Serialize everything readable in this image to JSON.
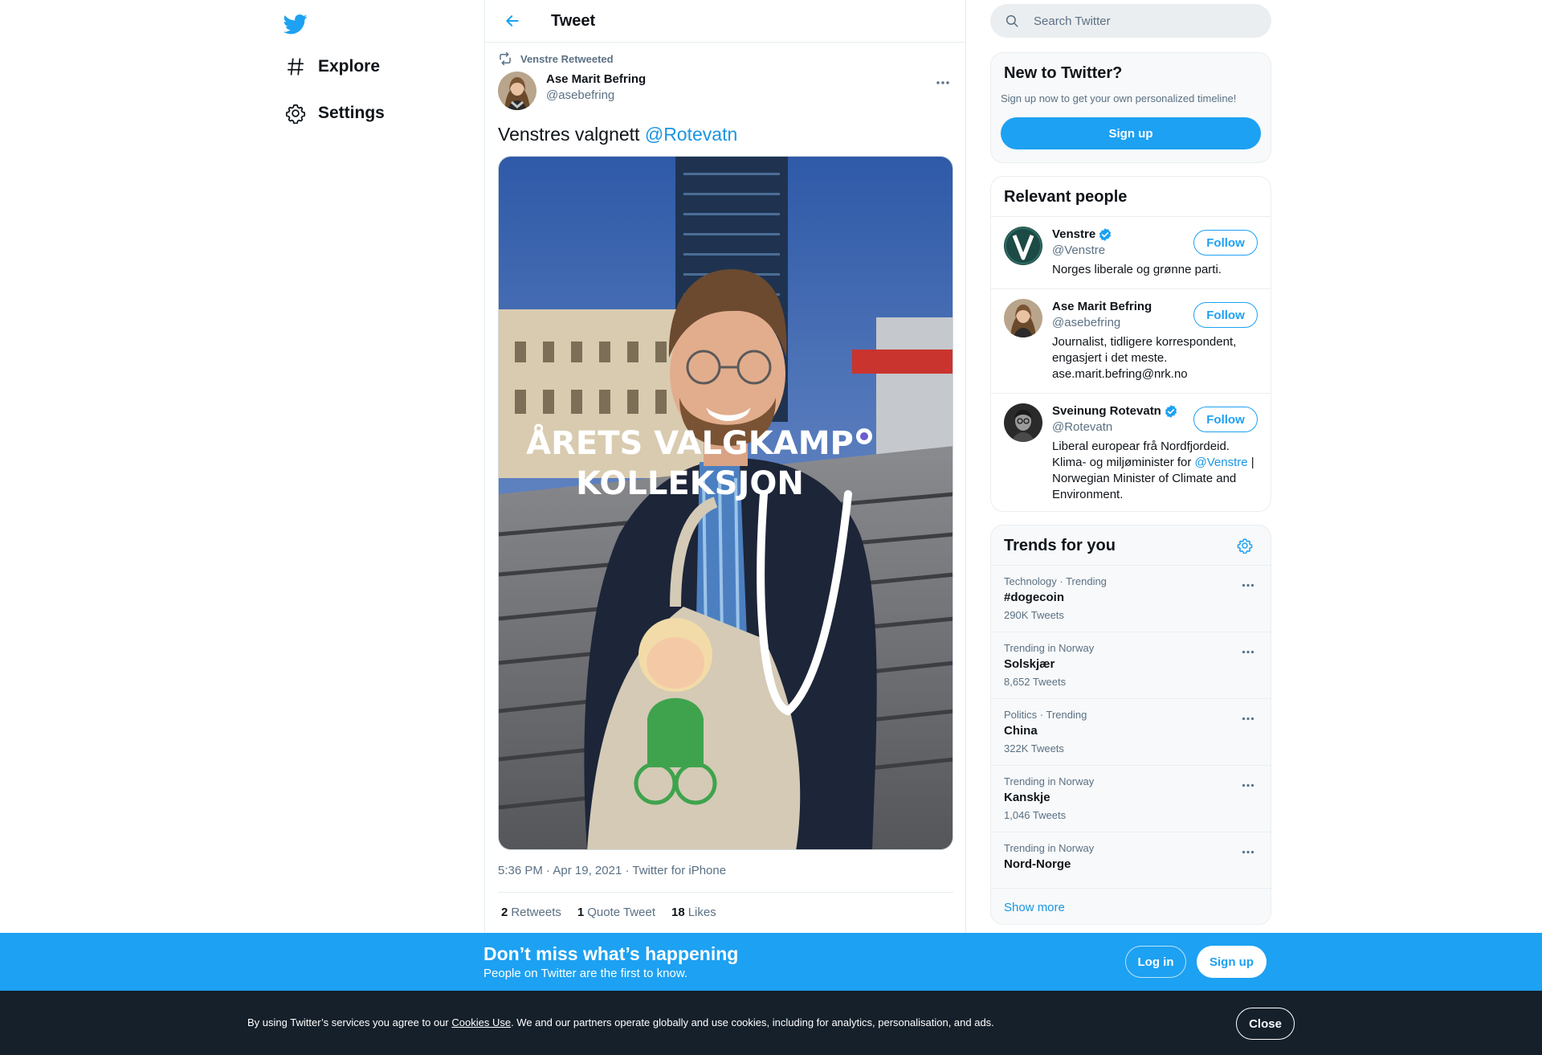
{
  "nav": {
    "logo_icon": "twitter-bird-icon",
    "items": [
      {
        "label": "Explore",
        "icon": "hash-icon"
      },
      {
        "label": "Settings",
        "icon": "gear-icon"
      }
    ]
  },
  "header": {
    "title": "Tweet",
    "back_icon": "arrow-left-icon"
  },
  "tweet": {
    "retweeted_by": "Venstre Retweeted",
    "author_name": "Ase Marit Befring",
    "author_handle": "@asebefring",
    "text": "Venstres valgnett ",
    "mention": "@Rotevatn",
    "media_caption_line1": "ÅRETS VALGKAMP",
    "media_caption_line2": "KOLLEKSJON",
    "time": "5:36 PM",
    "date": "Apr 19, 2021",
    "separator": " · ",
    "source": "Twitter for iPhone",
    "stats": {
      "retweets_count": "2",
      "retweets_label": "Retweets",
      "quotes_count": "1",
      "quotes_label": "Quote Tweet",
      "likes_count": "18",
      "likes_label": "Likes"
    }
  },
  "search": {
    "placeholder": "Search Twitter"
  },
  "new_to_twitter": {
    "title": "New to Twitter?",
    "subtitle": "Sign up now to get your own personalized timeline!",
    "button": "Sign up"
  },
  "relevant_people": {
    "title": "Relevant people",
    "follow_label": "Follow",
    "people": [
      {
        "name": "Venstre",
        "handle": "@Venstre",
        "verified": true,
        "bio": "Norges liberale og grønne parti."
      },
      {
        "name": "Ase Marit Befring",
        "handle": "@asebefring",
        "verified": false,
        "bio": "Journalist, tidligere korrespondent, engasjert i det meste. ase.marit.befring@nrk.no"
      },
      {
        "name": "Sveinung Rotevatn",
        "handle": "@Rotevatn",
        "verified": true,
        "bio_before": "Liberal europear frå Nordfjordeid. Klima- og miljøminister for ",
        "bio_mention": "@Venstre",
        "bio_after": " | Norwegian Minister of Climate and Environment."
      }
    ]
  },
  "trends": {
    "title": "Trends for you",
    "items": [
      {
        "context": "Technology · Trending",
        "name": "#dogecoin",
        "count": "290K Tweets"
      },
      {
        "context": "Trending in Norway",
        "name": "Solskjær",
        "count": "8,652 Tweets"
      },
      {
        "context": "Politics · Trending",
        "name": "China",
        "count": "322K Tweets"
      },
      {
        "context": "Trending in Norway",
        "name": "Kanskje",
        "count": "1,046 Tweets"
      },
      {
        "context": "Trending in Norway",
        "name": "Nord-Norge",
        "count": ""
      }
    ],
    "show_more": "Show more"
  },
  "promo": {
    "headline": "Don’t miss what’s happening",
    "subtext": "People on Twitter are the first to know.",
    "login": "Log in",
    "signup": "Sign up"
  },
  "cookie": {
    "before": "By using Twitter’s services you agree to our ",
    "link": "Cookies Use",
    "after": ". We and our partners operate globally and use cookies, including for analytics, personalisation, and ads.",
    "close": "Close"
  },
  "colors": {
    "brand": "#1da1f2",
    "link": "#1b95e0",
    "text": "#0f1419",
    "muted": "#5b7083",
    "dark": "#15202b"
  }
}
